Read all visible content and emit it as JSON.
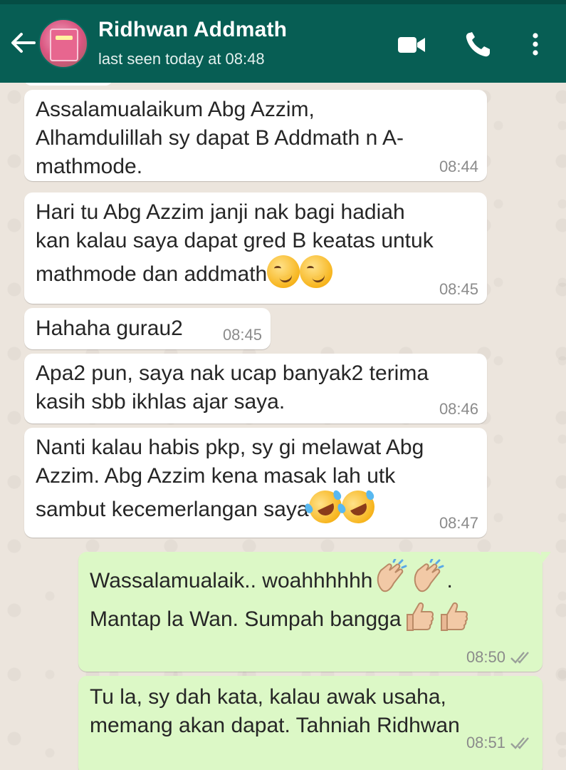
{
  "header": {
    "contact_name": "Ridhwan Addmath",
    "last_seen": "last seen today at 08:48",
    "icons": [
      "back-arrow-icon",
      "video-call-icon",
      "phone-icon",
      "more-vert-icon"
    ],
    "colors": {
      "bar": "#075e54",
      "status": "#054d44"
    }
  },
  "messages": [
    {
      "direction": "in",
      "lines": [
        "Assalamualaikum Abg Azzim,",
        "Alhamdulillah sy dapat B Addmath n A-",
        "mathmode."
      ],
      "time": "08:44"
    },
    {
      "direction": "in",
      "lines": [
        "Hari tu Abg Azzim janji nak bagi hadiah",
        "kan kalau saya dapat gred B keatas untuk",
        "mathmode dan addmath"
      ],
      "emoji": [
        "smirking-face",
        "smirking-face"
      ],
      "time": "08:45"
    },
    {
      "direction": "in",
      "lines": [
        "Hahaha gurau2"
      ],
      "time": "08:45"
    },
    {
      "direction": "in",
      "lines": [
        "Apa2 pun, saya nak ucap banyak2 terima",
        "kasih sbb ikhlas ajar saya."
      ],
      "time": "08:46"
    },
    {
      "direction": "in",
      "lines": [
        "Nanti kalau habis pkp, sy gi melawat Abg",
        "Azzim. Abg Azzim kena masak lah utk",
        "sambut kecemerlangan saya"
      ],
      "emoji": [
        "rolling-laughing-face",
        "rolling-laughing-face"
      ],
      "time": "08:47"
    },
    {
      "direction": "out",
      "line1": "Wassalamualaik.. woahhhhhh",
      "line1_end": ".",
      "line2": "Mantap la  Wan. Sumpah bangga",
      "emoji": [
        "clapping-hands",
        "clapping-hands",
        "thumbs-up",
        "thumbs-up"
      ],
      "time": "08:50",
      "status": "read-double-tick"
    },
    {
      "direction": "out",
      "lines": [
        "Tu la, sy dah kata, kalau awak usaha,",
        "memang akan dapat. Tahniah Ridhwan"
      ],
      "time": "08:51",
      "status": "read-double-tick"
    }
  ],
  "colors": {
    "incoming": "#ffffff",
    "outgoing": "#dcf8c6",
    "wallpaper": "#ece5dd"
  }
}
